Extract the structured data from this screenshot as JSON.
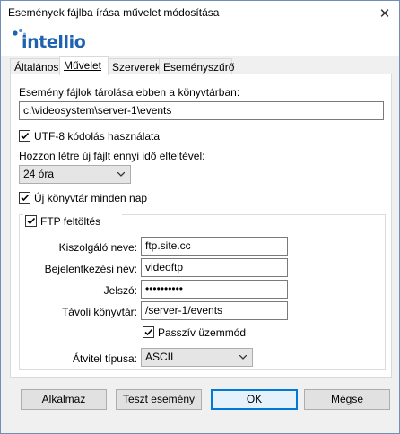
{
  "window": {
    "title": "Események fájlba írása művelet módosítása",
    "close_glyph": "✕"
  },
  "logo": {
    "text": "intellio",
    "accent_color": "#1f63b0"
  },
  "tabs": [
    {
      "label": "Általános",
      "active": false
    },
    {
      "label": "Művelet",
      "active": true
    },
    {
      "label": "Szerverek",
      "active": false
    },
    {
      "label": "Eseményszűrő",
      "active": false
    }
  ],
  "form": {
    "dir_label": "Esemény fájlok tárolása ebben a könyvtárban:",
    "dir_value": "c:\\videosystem\\server-1\\events",
    "utf8_label": "UTF-8 kódolás használata",
    "utf8_checked": true,
    "newfile_label": "Hozzon létre új fájlt ennyi idő elteltével:",
    "newfile_value": "24 óra",
    "newdir_label": "Új könyvtár minden nap",
    "newdir_checked": true
  },
  "ftp": {
    "legend": "FTP feltöltés",
    "enabled": true,
    "server_label": "Kiszolgáló neve:",
    "server_value": "ftp.site.cc",
    "login_label": "Bejelentkezési név:",
    "login_value": "videoftp",
    "password_label": "Jelszó:",
    "password_value": "••••••••••",
    "remote_dir_label": "Távoli könyvtár:",
    "remote_dir_value": "/server-1/events",
    "passive_label": "Passzív üzemmód",
    "passive_checked": true,
    "transfer_label": "Átvitel típusa:",
    "transfer_value": "ASCII"
  },
  "buttons": {
    "apply": "Alkalmaz",
    "test": "Teszt esemény",
    "ok": "OK",
    "cancel": "Mégse"
  }
}
